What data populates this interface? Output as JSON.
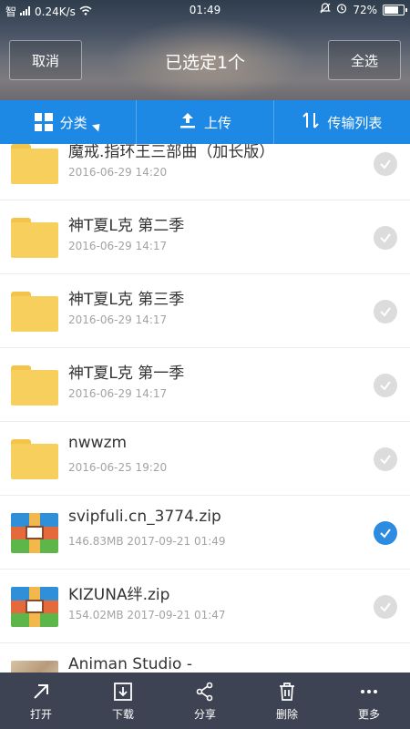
{
  "status_bar": {
    "carrier": "智",
    "network_speed": "0.24K/s",
    "time": "01:49",
    "battery": "72%"
  },
  "header": {
    "cancel_label": "取消",
    "title": "已选定1个",
    "select_all_label": "全选"
  },
  "toolbar": {
    "category_label": "分类",
    "upload_label": "上传",
    "transfer_label": "传输列表"
  },
  "files": [
    {
      "name": "魔戒.指环王三部曲（加长版）",
      "meta": "2016-06-29  14:20",
      "type": "folder",
      "selected": false
    },
    {
      "name": "神T夏L克 第二季",
      "meta": "2016-06-29  14:17",
      "type": "folder",
      "selected": false
    },
    {
      "name": "神T夏L克 第三季",
      "meta": "2016-06-29  14:17",
      "type": "folder",
      "selected": false
    },
    {
      "name": "神T夏L克 第一季",
      "meta": "2016-06-29  14:17",
      "type": "folder",
      "selected": false
    },
    {
      "name": "nwwzm",
      "meta": "2016-06-25  19:20",
      "type": "folder",
      "selected": false
    },
    {
      "name": "svipfuli.cn_3774.zip",
      "meta": "146.83MB   2017-09-21  01:49",
      "type": "zip",
      "selected": true
    },
    {
      "name": "KIZUNA绊.zip",
      "meta": "154.02MB   2017-09-21  01:47",
      "type": "zip",
      "selected": false
    },
    {
      "name": "Animan Studio -",
      "meta": "",
      "type": "image",
      "selected": false
    }
  ],
  "bottom_bar": {
    "open_label": "打开",
    "download_label": "下载",
    "share_label": "分享",
    "delete_label": "删除",
    "more_label": "更多"
  },
  "colors": {
    "toolbar_blue": "#1e88e5",
    "bottom_bar": "#3d4352",
    "check_selected": "#2d8be0"
  }
}
